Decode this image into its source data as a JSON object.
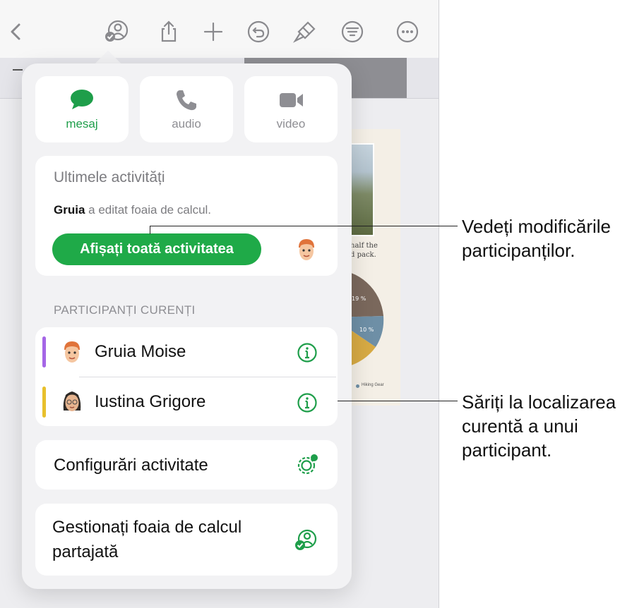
{
  "communication": {
    "message_label": "mesaj",
    "audio_label": "audio",
    "video_label": "video"
  },
  "recent_activity": {
    "title": "Ultimele activități",
    "editor_name": "Gruia",
    "edit_text": "a editat foaia de calcul.",
    "show_all_button": "Afișați toată activitatea"
  },
  "participants": {
    "header": "PARTICIPANȚI CURENȚI",
    "items": [
      {
        "name": "Gruia Moise",
        "color": "#a566e6"
      },
      {
        "name": "Iustina Grigore",
        "color": "#e8c02c"
      }
    ]
  },
  "settings": {
    "activity_settings": "Configurări activitate",
    "manage_shared": "Gestionați foaia de calcul partajată"
  },
  "background_doc": {
    "caption_line1": "half the",
    "caption_line2": "d pack.",
    "pie_labels": [
      "19 %",
      "10 %"
    ],
    "legend": "Hiking Gear"
  },
  "callouts": {
    "see_changes": "Vedeți modificările participanților.",
    "jump_location": "Săriți la localizarea curentă a unui participant."
  },
  "colors": {
    "accent": "#1faa48",
    "icon_green": "#1e9e4a"
  }
}
